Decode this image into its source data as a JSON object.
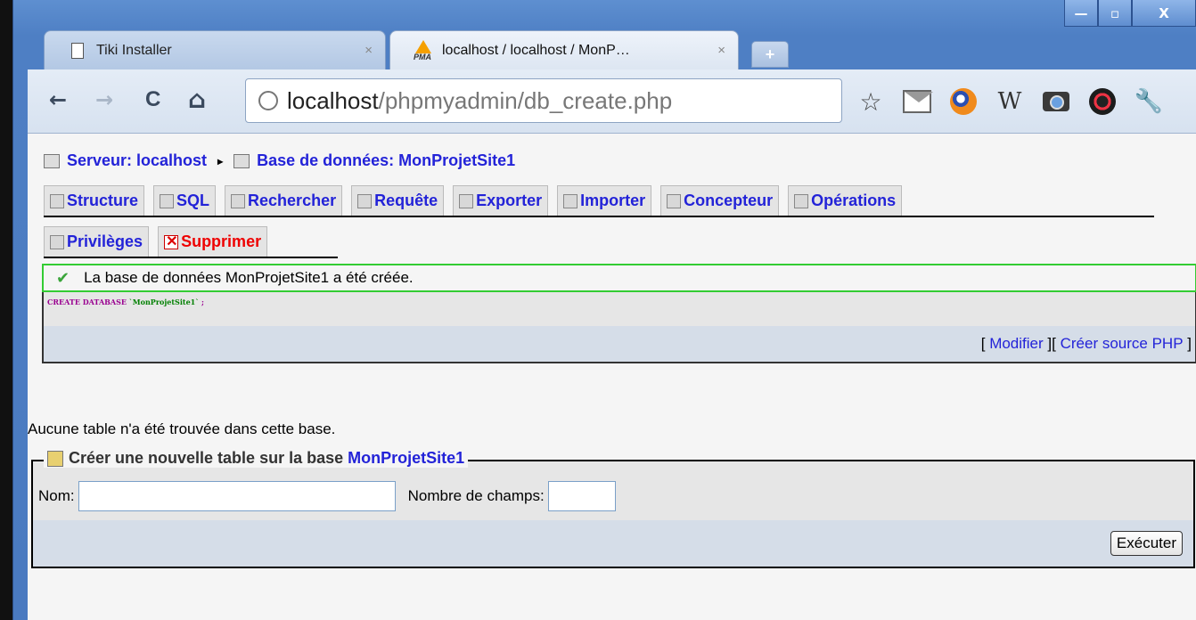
{
  "browser": {
    "window_controls": {
      "minimize": "—",
      "maximize": "▫",
      "close": "X"
    },
    "tabs": [
      {
        "title": "Tiki Installer",
        "icon": "document-icon",
        "active": false
      },
      {
        "title": "localhost / localhost / MonP…",
        "icon": "phpmyadmin-icon",
        "icon_text": "PMA",
        "active": true
      }
    ],
    "tab_close_glyph": "×",
    "new_tab_glyph": "+",
    "nav": {
      "back": "←",
      "forward": "→",
      "reload": "C",
      "home": "⌂"
    },
    "url": {
      "host": "localhost",
      "path": "/phpmyadmin/db_create.php"
    },
    "toolbar_icons": {
      "star": "☆",
      "gmail": "gmail-icon",
      "orb": "orb-icon",
      "w": "W",
      "camera": "camera-icon",
      "ball": "ball-icon",
      "wrench": "🔧"
    }
  },
  "breadcrumb": {
    "server_label": "Serveur: localhost",
    "separator": "▸",
    "database_label": "Base de données: MonProjetSite1"
  },
  "db_tabs": {
    "row1": [
      "Structure",
      "SQL",
      "Rechercher",
      "Requête",
      "Exporter",
      "Importer",
      "Concepteur",
      "Opérations"
    ],
    "row2": [
      "Privilèges",
      "Supprimer"
    ]
  },
  "notice": {
    "check": "✔",
    "message": "La base de données MonProjetSite1 a été créée."
  },
  "sql": {
    "keyword": "CREATE DATABASE",
    "identifier": "`MonProjetSite1`",
    "terminator": " ;",
    "links": {
      "open1": "[",
      "edit": "Modifier",
      "close1": "]",
      "open2": " [",
      "php": "Créer source PHP",
      "close2": "]"
    }
  },
  "empty_message": "Aucune table n'a été trouvée dans cette base.",
  "create_table": {
    "legend_prefix": "Créer une nouvelle table sur la base",
    "legend_db": "MonProjetSite1",
    "name_label": "Nom:",
    "fields_label": "Nombre de champs:",
    "name_value": "",
    "fields_value": "",
    "submit": "Exécuter"
  }
}
